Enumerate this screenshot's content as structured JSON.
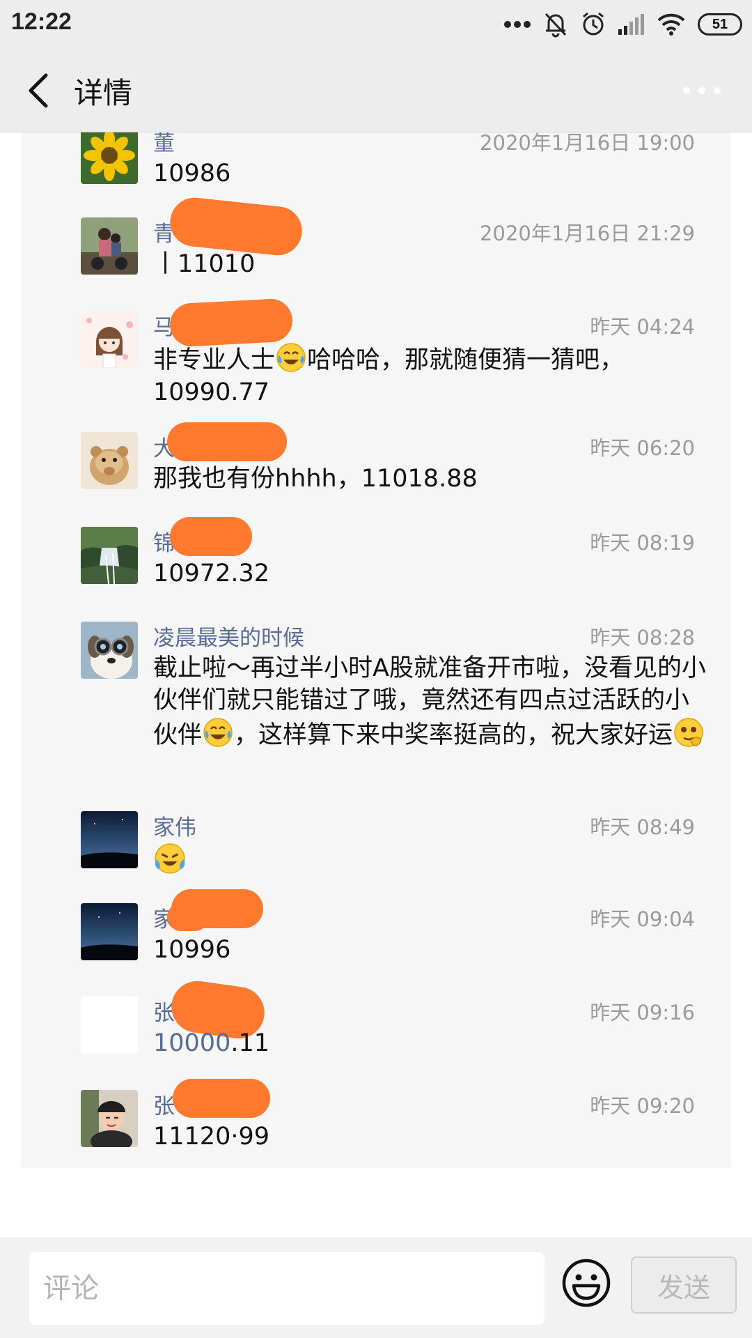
{
  "status_bar": {
    "time": "12:22",
    "battery": "51"
  },
  "header": {
    "title": "详情"
  },
  "comments": [
    {
      "name": "董",
      "time": "2020年1月16日 19:00",
      "content": "10986",
      "avatar_icon": "sunflower-avatar-icon"
    },
    {
      "name": "青",
      "time": "2020年1月16日 21:29",
      "content": "丨11010",
      "avatar_icon": "motorbike-avatar-icon"
    },
    {
      "name": "马",
      "time": "昨天 04:24",
      "content_a": "非专业人士",
      "content_b": "哈哈哈，那就随便猜一猜吧，10990.77",
      "avatar_icon": "anime-girl-avatar-icon"
    },
    {
      "name": "大",
      "time": "昨天 06:20",
      "content": "那我也有份hhhh，11018.88",
      "avatar_icon": "hamster-avatar-icon"
    },
    {
      "name": "锦",
      "time": "昨天 08:19",
      "content": "10972.32",
      "avatar_icon": "waterfall-avatar-icon"
    },
    {
      "name": "凌晨最美的时候",
      "time": "昨天 08:28",
      "content_a": "截止啦～再过半小时A股就准备开市啦，没看见的小伙伴们就只能错过了哦，竟然还有四点过活跃的小伙伴",
      "content_b": "，这样算下来中奖率挺高的，祝大家好运",
      "avatar_icon": "dog-goggles-avatar-icon"
    },
    {
      "name": "家伟",
      "time": "昨天 08:49",
      "avatar_icon": "night-sky-avatar-icon"
    },
    {
      "name": "家",
      "time": "昨天 09:04",
      "content": "10996",
      "avatar_icon": "night-sky-avatar-icon"
    },
    {
      "name": "张",
      "time": "昨天 09:16",
      "content_link": "10000",
      "content_rest": ".11",
      "avatar_icon": "blank-avatar-icon"
    },
    {
      "name": "张",
      "time": "昨天 09:20",
      "content": "11120·99",
      "avatar_icon": "girl-cap-avatar-icon"
    }
  ],
  "input": {
    "placeholder": "评论",
    "send_label": "发送"
  },
  "colors": {
    "name_blue": "#576b95",
    "redaction": "#ff7a2e",
    "panel": "#f6f6f6",
    "bar": "#ededed"
  }
}
